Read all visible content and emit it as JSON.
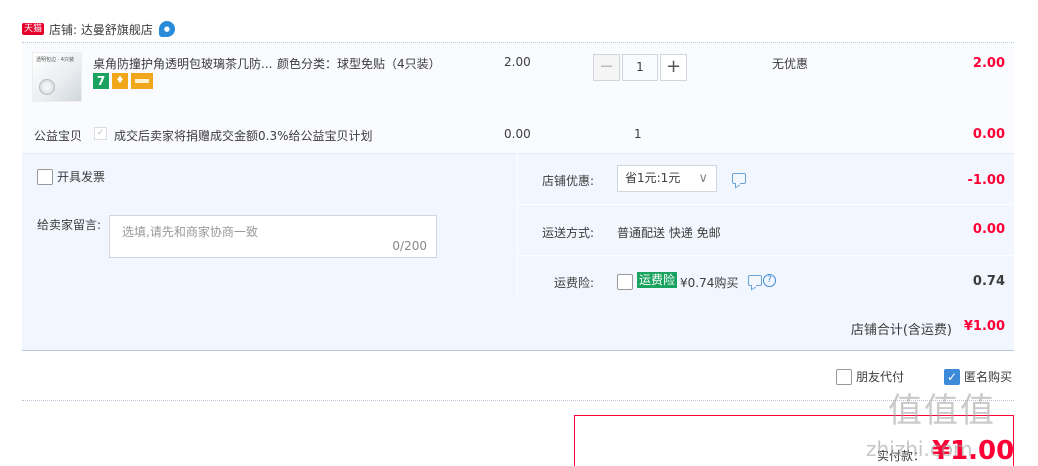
{
  "shop": {
    "badge": "天猫",
    "label": "店铺: 达曼舒旗舰店",
    "ww_icon": "●"
  },
  "item": {
    "thumb_caption": "透明包边 · 4只装",
    "title": "桌角防撞护角透明包玻璃茶几防...",
    "sku": "颜色分类：球型免贴（4只装）",
    "badge_7": "7",
    "badge_shield": "♦",
    "price": "2.00",
    "qty": "1",
    "minus": "−",
    "plus": "+",
    "discount": "无优惠",
    "total": "2.00"
  },
  "charity": {
    "label": "公益宝贝",
    "check": "✓",
    "text": "成交后卖家将捐赠成交金额0.3%给公益宝贝计划",
    "price": "0.00",
    "qty": "1",
    "total": "0.00"
  },
  "invoice": {
    "label": "开具发票"
  },
  "message": {
    "label": "给卖家留言:",
    "placeholder": "选填,请先和商家协商一致",
    "count": "0/200"
  },
  "shop_discount": {
    "label": "店铺优惠:",
    "value": "省1元:1元",
    "chevron": "∨",
    "total": "-1.00"
  },
  "shipping": {
    "label": "运送方式:",
    "value": "普通配送 快递 免邮",
    "total": "0.00"
  },
  "insurance": {
    "label": "运费险:",
    "badge": "运费险",
    "text": "¥0.74购买",
    "help": "?",
    "total": "0.74"
  },
  "shop_total": {
    "label": "店铺合计(含运费)",
    "value": "¥1.00"
  },
  "options": {
    "friend_pay": "朋友代付",
    "anonymous": "匿名购买",
    "anonymous_check": "✓"
  },
  "payment": {
    "label": "实付款：",
    "amount": "¥1.00"
  },
  "watermark": {
    "logo": "值值值",
    "site": "zhizhi.com"
  },
  "colors": {
    "accent": "#ff0036",
    "blue": "#3c8ad8",
    "green": "#1aa260",
    "panel": "#f2f7ff"
  }
}
